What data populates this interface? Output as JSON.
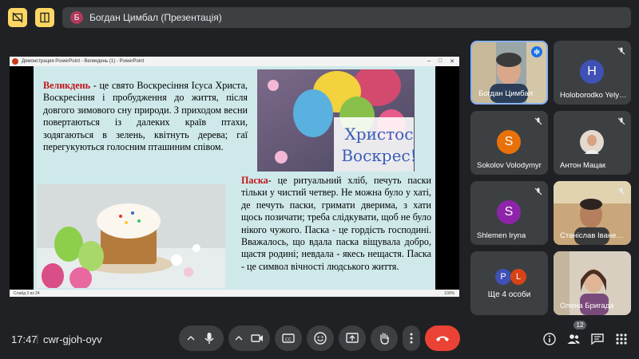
{
  "presenter_bar": {
    "avatar_letter": "Б",
    "text": "Богдан Цимбал (Презентація)"
  },
  "powerpoint": {
    "title": "Демонстрация PowerPoint - Великдень (1) - PowerPoint",
    "status_slide": "Слайд 3 из 34",
    "status_zoom": "100%"
  },
  "slide": {
    "p1_keyword": "Великдень",
    "p1_text": " - це свято Воскресіння Ісуса Христа, Воскресіння і пробудження до життя, після довгого зимового сну природи. З приходом весни повертаються із далеких країв птахи, зодягаються в зелень, квітнуть дерева; гаї перегукуються голосним пташиним співом.",
    "greeting_line1": "Христос",
    "greeting_line2": "Воскрес!",
    "p2_keyword": "Паска",
    "p2_text": "- це ритуальний хліб, печуть паски тільки у чистий четвер. Не можна було у хаті, де печуть паски, гримати дверима, з хати щось позичати; треба слідкувати, щоб не було нікого чужого. Паска - це гордість господині. Вважалось, що вдала паска віщувала добро, щастя родині; невдала - якесь нещастя. Паска - це символ вічності людського життя."
  },
  "participants": [
    {
      "name": "Богдан Цимбал",
      "type": "video",
      "mic": "speaking"
    },
    {
      "name": "Holoborodko Yelyzaveta",
      "type": "avatar",
      "letter": "H",
      "color": "#3f51b5",
      "mic": "off"
    },
    {
      "name": "Sokolov Volodymyr",
      "type": "avatar",
      "letter": "S",
      "color": "#e8710a",
      "mic": "off"
    },
    {
      "name": "Антон Мацак",
      "type": "photo",
      "mic": "off"
    },
    {
      "name": "Shlemen Iryna",
      "type": "avatar",
      "letter": "S",
      "color": "#8e24aa",
      "mic": "off"
    },
    {
      "name": "Станіслав Іваненко",
      "type": "video",
      "mic": "off"
    },
    {
      "name": "Ще 4 особи",
      "type": "group",
      "letters": [
        "P",
        "L"
      ],
      "colors": [
        "#3f51b5",
        "#d84315"
      ]
    },
    {
      "name": "Олена Бригада",
      "type": "video",
      "mic": "none"
    }
  ],
  "bottom": {
    "time": "17:47",
    "separator": "|",
    "meeting_code": "cwr-gjoh-oyv",
    "people_count": "12"
  },
  "colors": {
    "background": "#202124",
    "tile": "#3c4043",
    "accent_yellow": "#fdd663",
    "end_call_red": "#ea4335",
    "speaking_blue": "#1a73e8"
  }
}
